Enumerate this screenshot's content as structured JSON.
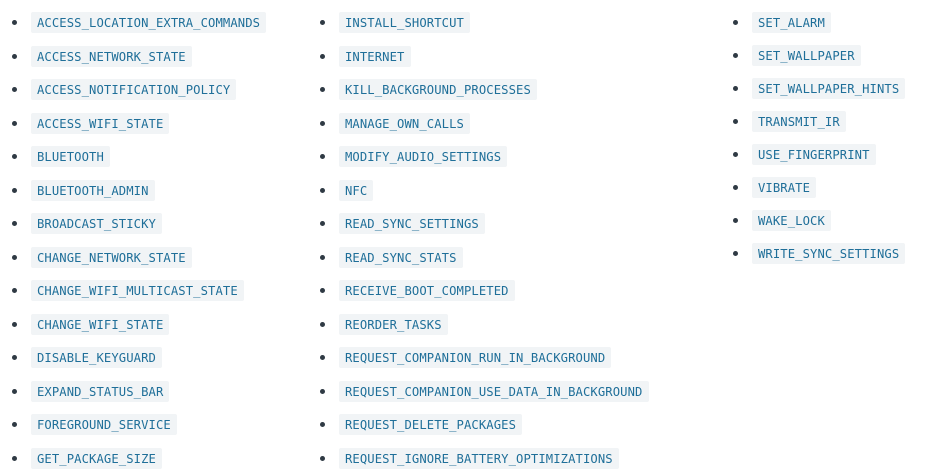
{
  "columns": [
    {
      "items": [
        "ACCESS_LOCATION_EXTRA_COMMANDS",
        "ACCESS_NETWORK_STATE",
        "ACCESS_NOTIFICATION_POLICY",
        "ACCESS_WIFI_STATE",
        "BLUETOOTH",
        "BLUETOOTH_ADMIN",
        "BROADCAST_STICKY",
        "CHANGE_NETWORK_STATE",
        "CHANGE_WIFI_MULTICAST_STATE",
        "CHANGE_WIFI_STATE",
        "DISABLE_KEYGUARD",
        "EXPAND_STATUS_BAR",
        "FOREGROUND_SERVICE",
        "GET_PACKAGE_SIZE"
      ]
    },
    {
      "items": [
        "INSTALL_SHORTCUT",
        "INTERNET",
        "KILL_BACKGROUND_PROCESSES",
        "MANAGE_OWN_CALLS",
        "MODIFY_AUDIO_SETTINGS",
        "NFC",
        "READ_SYNC_SETTINGS",
        "READ_SYNC_STATS",
        "RECEIVE_BOOT_COMPLETED",
        "REORDER_TASKS",
        "REQUEST_COMPANION_RUN_IN_BACKGROUND",
        "REQUEST_COMPANION_USE_DATA_IN_BACKGROUND",
        "REQUEST_DELETE_PACKAGES",
        "REQUEST_IGNORE_BATTERY_OPTIMIZATIONS"
      ]
    },
    {
      "items": [
        "SET_ALARM",
        "SET_WALLPAPER",
        "SET_WALLPAPER_HINTS",
        "TRANSMIT_IR",
        "USE_FINGERPRINT",
        "VIBRATE",
        "WAKE_LOCK",
        "WRITE_SYNC_SETTINGS"
      ]
    }
  ]
}
